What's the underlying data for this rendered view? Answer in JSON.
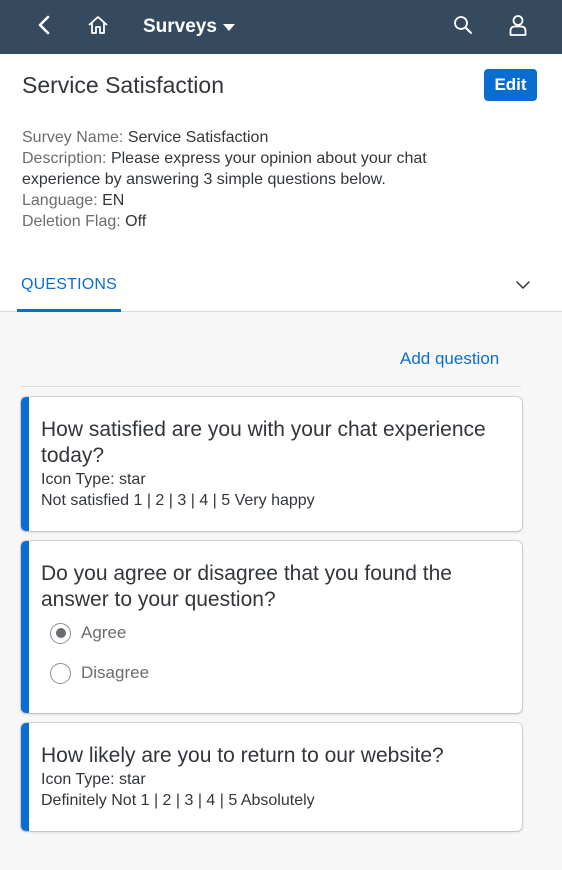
{
  "shell": {
    "title": "Surveys",
    "icons": [
      "back-icon",
      "home-icon",
      "search-icon",
      "user-icon"
    ]
  },
  "header": {
    "title": "Service Satisfaction",
    "edit_label": "Edit",
    "attributes": [
      {
        "label": "Survey Name:",
        "value": "Service Satisfaction"
      },
      {
        "label": "Description:",
        "value": "Please express your opinion about your chat experience by answering 3 simple questions below."
      },
      {
        "label": "Language:",
        "value": "EN"
      },
      {
        "label": "Deletion Flag:",
        "value": "Off"
      }
    ],
    "tab_label": "QUESTIONS"
  },
  "content": {
    "add_question_label": "Add question",
    "questions": [
      {
        "text": "How satisfied are you with your chat experience today?",
        "icon_type": "Icon Type: star",
        "scale": "Not satisfied 1 | 2 | 3 | 4 | 5 Very happy"
      },
      {
        "text": "Do you agree or disagree that you found the answer to your question?",
        "options": [
          {
            "label": "Agree",
            "selected": true
          },
          {
            "label": "Disagree",
            "selected": false
          }
        ]
      },
      {
        "text": "How likely are you to return to our website?",
        "icon_type": "Icon Type: star",
        "scale": "Definitely Not 1 | 2 | 3 | 4 | 5 Absolutely"
      }
    ]
  },
  "colors": {
    "shell_bg": "#354a5f",
    "accent": "#0a6ed1",
    "text": "#32363a",
    "label": "#6a6d70"
  }
}
